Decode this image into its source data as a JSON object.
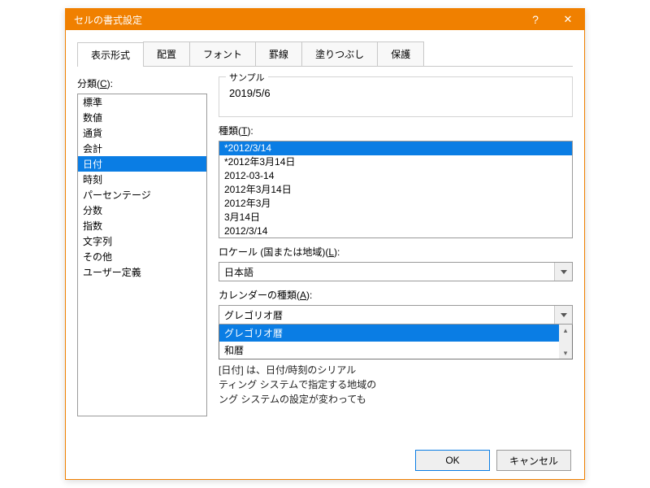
{
  "window": {
    "title": "セルの書式設定",
    "help": "?",
    "close": "✕"
  },
  "tabs": [
    "表示形式",
    "配置",
    "フォント",
    "罫線",
    "塗りつぶし",
    "保護"
  ],
  "category_label_pre": "分類(",
  "category_label_key": "C",
  "category_label_post": "):",
  "categories": [
    "標準",
    "数値",
    "通貨",
    "会計",
    "日付",
    "時刻",
    "パーセンテージ",
    "分数",
    "指数",
    "文字列",
    "その他",
    "ユーザー定義"
  ],
  "category_selected_index": 4,
  "sample_label": "サンプル",
  "sample_value": "2019/5/6",
  "type_label_pre": "種類(",
  "type_label_key": "T",
  "type_label_post": "):",
  "types": [
    "*2012/3/14",
    "*2012年3月14日",
    "2012-03-14",
    "2012年3月14日",
    "2012年3月",
    "3月14日",
    "2012/3/14"
  ],
  "type_selected_index": 0,
  "locale_label_pre": "ロケール (国または地域)(",
  "locale_label_key": "L",
  "locale_label_post": "):",
  "locale_value": "日本語",
  "calendar_label_pre": "カレンダーの種類(",
  "calendar_label_key": "A",
  "calendar_label_post": "):",
  "calendar_value": "グレゴリオ暦",
  "calendar_options": [
    "グレゴリオ暦",
    "和暦"
  ],
  "calendar_selected_index": 0,
  "description_line1": "[日付] は、日付/時刻のシリアル",
  "description_line2": "ティング システムで指定する地域の",
  "description_line3": "ング システムの設定が変わっても",
  "buttons": {
    "ok": "OK",
    "cancel": "キャンセル"
  }
}
